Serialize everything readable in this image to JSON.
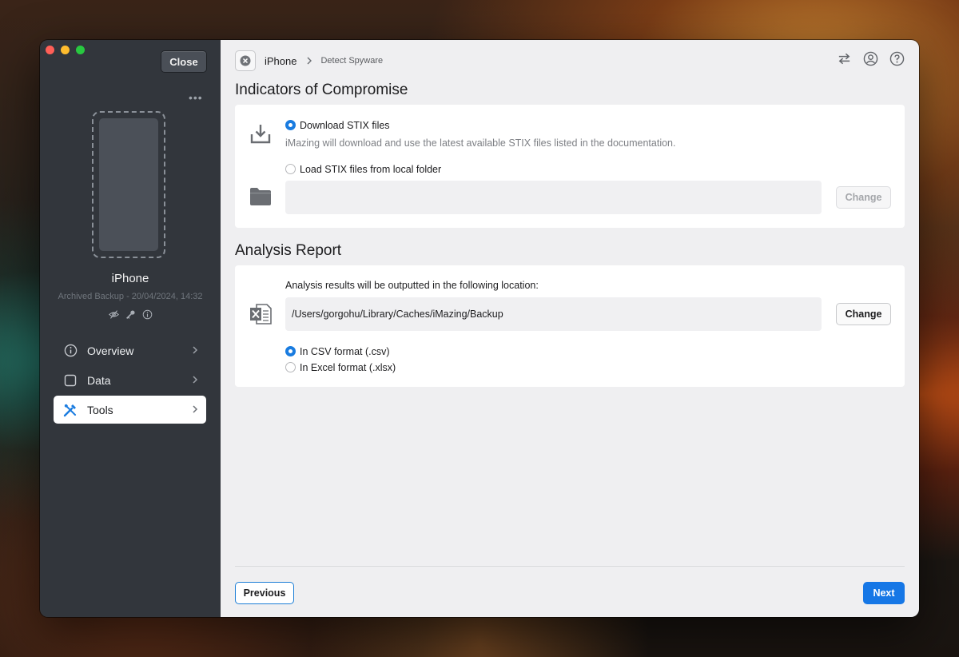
{
  "sidebar": {
    "close_label": "Close",
    "more_label": "•••",
    "device_name": "iPhone",
    "device_subtitle": "Archived Backup - 20/04/2024, 14:32",
    "nav": [
      {
        "label": "Overview",
        "icon": "info-circle-icon",
        "active": false
      },
      {
        "label": "Data",
        "icon": "square-icon",
        "active": false
      },
      {
        "label": "Tools",
        "icon": "tools-icon",
        "active": true
      }
    ]
  },
  "breadcrumb": {
    "device": "iPhone",
    "page": "Detect Spyware"
  },
  "ioc": {
    "title": "Indicators of Compromise",
    "option_download": "Download STIX files",
    "download_hint": "iMazing will download and use the latest available STIX files listed in the documentation.",
    "option_local": "Load STIX files from local folder",
    "local_path": "",
    "change_label": "Change"
  },
  "report": {
    "title": "Analysis Report",
    "location_text": "Analysis results will be outputted in the following location:",
    "path": "/Users/gorgohu/Library/Caches/iMazing/Backup",
    "change_label": "Change",
    "format_csv": "In CSV format (.csv)",
    "format_xlsx": "In Excel format (.xlsx)",
    "selected_format": "csv"
  },
  "footer": {
    "previous_label": "Previous",
    "next_label": "Next"
  },
  "colors": {
    "accent": "#1677e6",
    "sidebar_bg": "#32363c",
    "main_bg": "#efeff1"
  }
}
